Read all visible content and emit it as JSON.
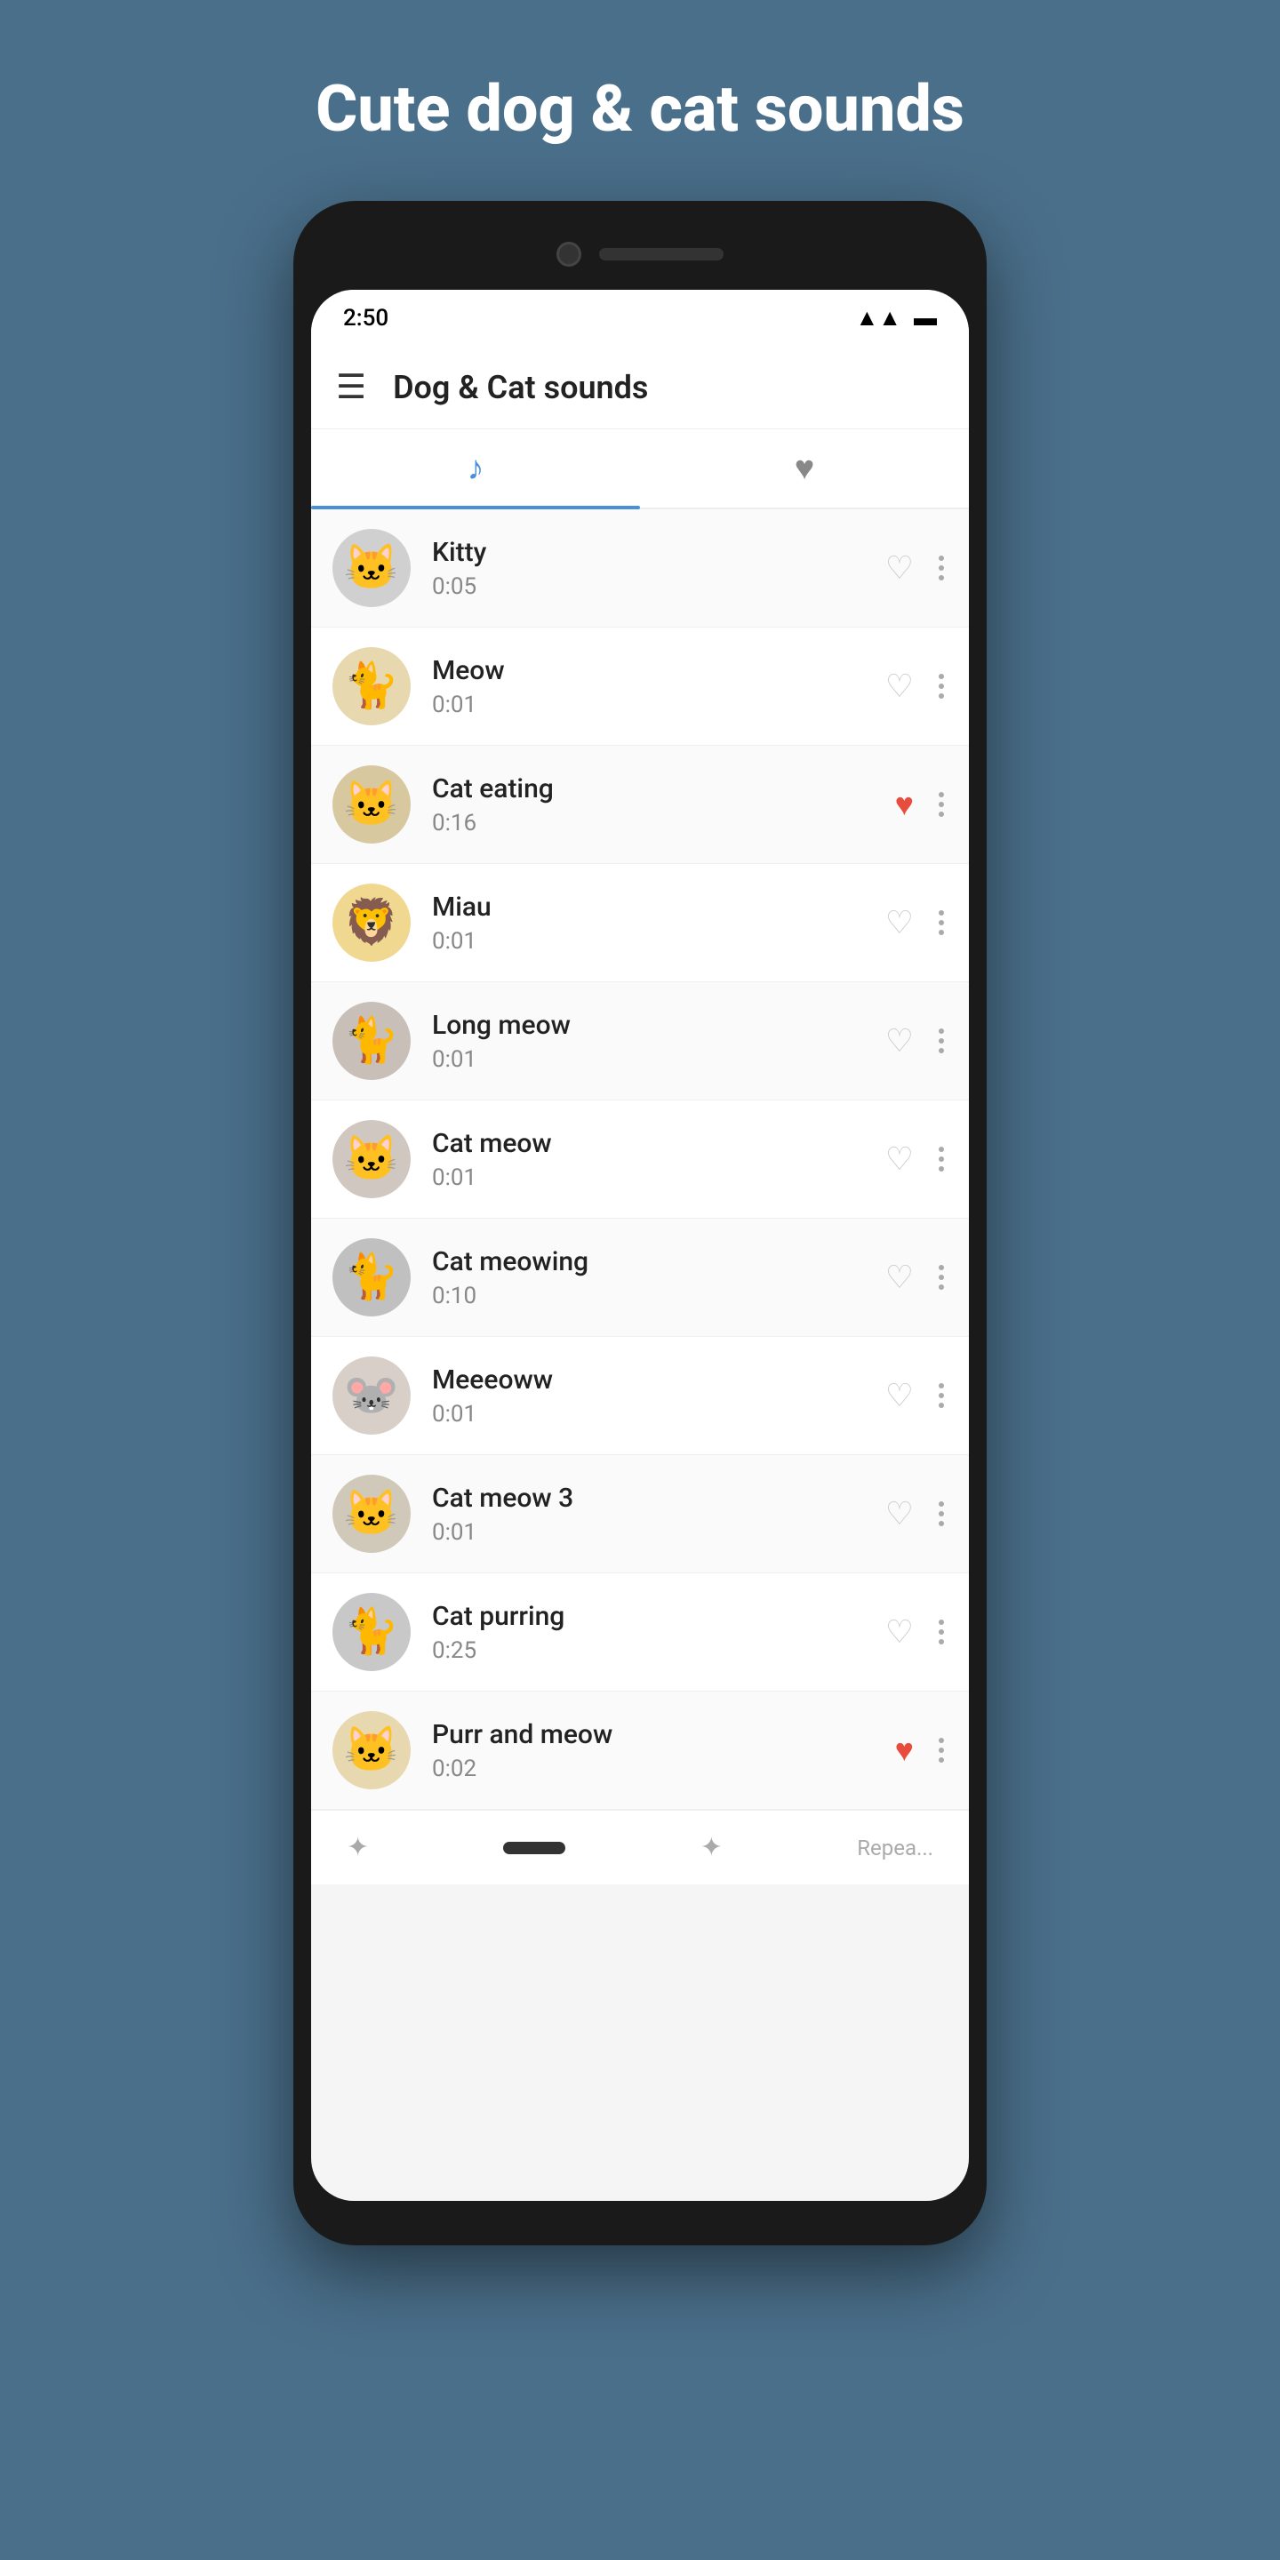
{
  "page": {
    "background_title": "Cute dog & cat sounds",
    "status": {
      "time": "2:50",
      "signal": "📶",
      "battery": "🔋"
    },
    "app": {
      "title": "Dog & Cat sounds",
      "hamburger": "☰"
    },
    "tabs": [
      {
        "id": "music",
        "icon": "♪",
        "active": true
      },
      {
        "id": "favorites",
        "icon": "♥",
        "active": false
      }
    ],
    "sounds": [
      {
        "name": "Kitty",
        "duration": "0:05",
        "favorite": false,
        "emoji": "🐱",
        "avatar_class": "avatar-kitty"
      },
      {
        "name": "Meow",
        "duration": "0:01",
        "favorite": false,
        "emoji": "🐈",
        "avatar_class": "avatar-meow"
      },
      {
        "name": "Cat eating",
        "duration": "0:16",
        "favorite": true,
        "emoji": "🐱",
        "avatar_class": "avatar-eating"
      },
      {
        "name": "Miau",
        "duration": "0:01",
        "favorite": false,
        "emoji": "🦁",
        "avatar_class": "avatar-miau"
      },
      {
        "name": "Long meow",
        "duration": "0:01",
        "favorite": false,
        "emoji": "🐈",
        "avatar_class": "avatar-longmeow"
      },
      {
        "name": "Cat meow",
        "duration": "0:01",
        "favorite": false,
        "emoji": "🐱",
        "avatar_class": "avatar-catmeow"
      },
      {
        "name": "Cat meowing",
        "duration": "0:10",
        "favorite": false,
        "emoji": "🐈",
        "avatar_class": "avatar-meowing"
      },
      {
        "name": "Meeeoww",
        "duration": "0:01",
        "favorite": false,
        "emoji": "🐭",
        "avatar_class": "avatar-meeeoww"
      },
      {
        "name": "Cat meow 3",
        "duration": "0:01",
        "favorite": false,
        "emoji": "🐱",
        "avatar_class": "avatar-catmeow3"
      },
      {
        "name": "Cat purring",
        "duration": "0:25",
        "favorite": false,
        "emoji": "🐈",
        "avatar_class": "avatar-purring"
      },
      {
        "name": "Purr and meow",
        "duration": "0:02",
        "favorite": true,
        "emoji": "🐱",
        "avatar_class": "avatar-purrandmeow"
      }
    ],
    "bottom_bar": {
      "repeat_label": "Repea..."
    }
  }
}
